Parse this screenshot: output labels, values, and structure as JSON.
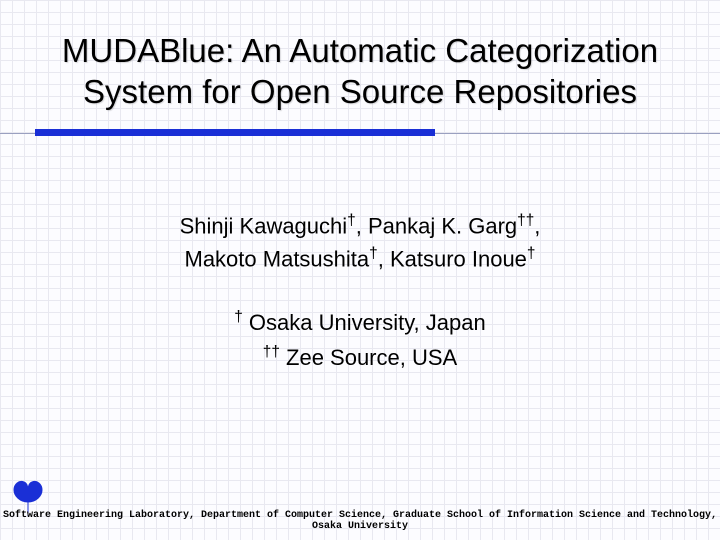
{
  "title": "MUDABlue: An Automatic Categorization System for Open Source Repositories",
  "authors": {
    "line1_a": "Shinji Kawaguchi",
    "line1_sup_a": "†",
    "line1_sep": ", ",
    "line1_b": "Pankaj K. Garg",
    "line1_sup_b": "††",
    "line1_end": ",",
    "line2_a": "Makoto Matsushita",
    "line2_sup_a": "†",
    "line2_sep": ", ",
    "line2_b": "Katsuro Inoue",
    "line2_sup_b": "†"
  },
  "affiliations": {
    "a_sup": "†",
    "a_text": " Osaka University, Japan",
    "b_sup": "††",
    "b_text": " Zee Source, USA"
  },
  "footer": "Software Engineering Laboratory, Department of Computer Science, Graduate School of Information Science and Technology, Osaka University"
}
